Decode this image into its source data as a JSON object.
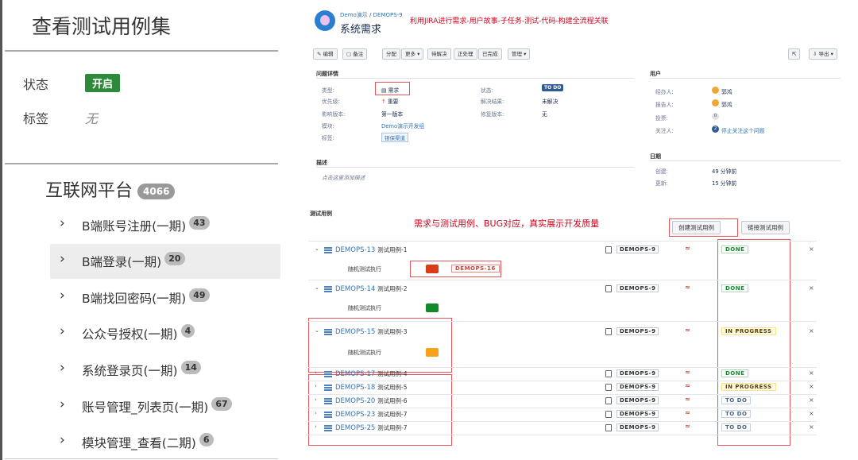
{
  "left": {
    "title": "查看测试用例集",
    "fields": {
      "status_label": "状态",
      "status_value": "开启",
      "tags_label": "标签",
      "tags_value": "无"
    },
    "group": {
      "name": "互联网平台",
      "count": "4066"
    },
    "items": [
      {
        "label": "B端账号注册(一期)",
        "count": "43"
      },
      {
        "label": "B端登录(一期)",
        "count": "20"
      },
      {
        "label": "B端找回密码(一期)",
        "count": "49"
      },
      {
        "label": "公众号授权(一期)",
        "count": "4"
      },
      {
        "label": "系统登录页(一期)",
        "count": "14"
      },
      {
        "label": "账号管理_列表页(一期)",
        "count": "67"
      },
      {
        "label": "模块管理_查看(二期)",
        "count": "6"
      }
    ]
  },
  "issue": {
    "breadcrumb_project": "Demo演示",
    "breadcrumb_sep": " / ",
    "breadcrumb_key": "DEMOPS-9",
    "summary": "系统需求",
    "annotation_title": "利用JIRA进行需求-用户故事-子任务-测试-代码-构建全流程关联",
    "toolbar": {
      "edit": "✎ 编辑",
      "comment": "▢ 备注",
      "assign": "分配",
      "more": "更多 ▾",
      "to_be_done": "待解决",
      "in_progress": "正处理",
      "done": "已完成",
      "manage": "管理 ▾",
      "share_icon": "⇱",
      "export": "⇩ 导出 ▾"
    },
    "details": {
      "section": "问题详情",
      "type_label": "类型:",
      "type_value": "需求",
      "priority_label": "优先级:",
      "priority_value": "重要",
      "affects_label": "影响版本:",
      "affects_value": "第一版本",
      "module_label": "模块:",
      "module_value": "Demo演示开发组",
      "tags_label": "标签:",
      "tags_value": "银保渠道",
      "status_label": "状态:",
      "status_value": "TO DO",
      "resolution_label": "解决结果:",
      "resolution_value": "未解决",
      "fix_label": "修复版本:",
      "fix_value": "无"
    },
    "people": {
      "section": "用户",
      "assignee_label": "经办人:",
      "assignee_value": "郭鸿",
      "reporter_label": "报告人:",
      "reporter_value": "郭鸿",
      "votes_label": "投票:",
      "votes_value": "0",
      "watchers_label": "关注人:",
      "watchers_count": "2",
      "watchers_value": "停止关注这个问题"
    },
    "dates": {
      "section": "日期",
      "created_label": "创建:",
      "created_value": "49 分钟前",
      "updated_label": "更新:",
      "updated_value": "15 分钟前"
    },
    "description": {
      "section": "描述",
      "placeholder": "点击这里添加描述"
    }
  },
  "testcases": {
    "section": "测试用例",
    "annotation": "需求与测试用例、BUG对应，真实展示开发质量",
    "create_button": "创建测试用例",
    "link_button": "链接测试用例",
    "exec_label": "随机测试执行",
    "colors": {
      "red": "#d93b16",
      "green": "#14892c",
      "orange": "#f6a21a"
    },
    "bug_key": "DEMOPS-16",
    "rows": [
      {
        "key": "DEMOPS-13",
        "name": "测试用例-1",
        "parent": "DEMOPS-9",
        "status": "DONE",
        "expanded": true,
        "exec_color": "red"
      },
      {
        "key": "DEMOPS-14",
        "name": "测试用例-2",
        "parent": "DEMOPS-9",
        "status": "DONE",
        "expanded": true,
        "exec_color": "green"
      },
      {
        "key": "DEMOPS-15",
        "name": "测试用例-3",
        "parent": "DEMOPS-9",
        "status": "IN PROGRESS",
        "expanded": true,
        "exec_color": "orange"
      },
      {
        "key": "DEMOPS-17",
        "name": "测试用例-4",
        "parent": "DEMOPS-9",
        "status": "DONE",
        "expanded": false
      },
      {
        "key": "DEMOPS-18",
        "name": "测试用例-5",
        "parent": "DEMOPS-9",
        "status": "IN PROGRESS",
        "expanded": false
      },
      {
        "key": "DEMOPS-20",
        "name": "测试用例-6",
        "parent": "DEMOPS-9",
        "status": "TO DO",
        "expanded": false
      },
      {
        "key": "DEMOPS-23",
        "name": "测试用例-7",
        "parent": "DEMOPS-9",
        "status": "TO DO",
        "expanded": false
      },
      {
        "key": "DEMOPS-25",
        "name": "测试用例-7",
        "parent": "DEMOPS-9",
        "status": "TO DO",
        "expanded": false
      }
    ]
  }
}
